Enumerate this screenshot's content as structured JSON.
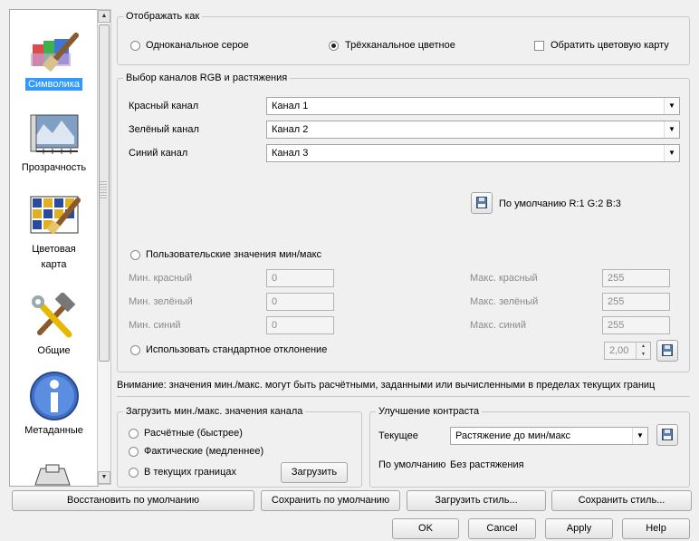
{
  "sidebar": {
    "items": [
      {
        "label": "Символика",
        "icon": "paintbrush-icon",
        "selected": true
      },
      {
        "label": "Прозрачность",
        "icon": "transparency-map-icon",
        "selected": false
      },
      {
        "label": "Цветовая карта",
        "icon": "color-map-icon",
        "selected": false
      },
      {
        "label": "Общие",
        "icon": "tools-icon",
        "selected": false
      },
      {
        "label": "Метаданные",
        "icon": "info-icon",
        "selected": false
      }
    ]
  },
  "display_as": {
    "title": "Отображать как",
    "single_gray": "Одноканальное серое",
    "three_color": "Трёхканальное цветное",
    "invert_map": "Обратить цветовую карту"
  },
  "rgb": {
    "title": "Выбор каналов RGB и растяжения",
    "red_label": "Красный канал",
    "red_value": "Канал 1",
    "green_label": "Зелёный канал",
    "green_value": "Канал 2",
    "blue_label": "Синий канал",
    "blue_value": "Канал 3",
    "default_text": "По умолчанию R:1 G:2 B:3",
    "custom_minmax": "Пользовательские значения мин/макс",
    "min_red_label": "Мин. красный",
    "min_red": "0",
    "min_green_label": "Мин. зелёный",
    "min_green": "0",
    "min_blue_label": "Мин. синий",
    "min_blue": "0",
    "max_red_label": "Макс. красный",
    "max_red": "255",
    "max_green_label": "Макс. зелёный",
    "max_green": "255",
    "max_blue_label": "Макс. синий",
    "max_blue": "255",
    "stddev_label": "Использовать стандартное отклонение",
    "stddev_value": "2,00"
  },
  "warning": "Внимание: значения мин./макс. могут быть расчётными, заданными или вычисленными в пределах текущих границ",
  "load_minmax": {
    "title": "Загрузить мин./макс. значения канала",
    "estimate": "Расчётные (быстрее)",
    "actual": "Фактические (медленнее)",
    "current_extent": "В текущих границах",
    "load_button": "Загрузить"
  },
  "contrast": {
    "title": "Улучшение контраста",
    "current_label": "Текущее",
    "current_value": "Растяжение до мин/макс",
    "default_label": "По умолчанию",
    "default_value": "Без растяжения"
  },
  "bottom": {
    "restore_default": "Восстановить по умолчанию",
    "save_default": "Сохранить по умолчанию",
    "load_style": "Загрузить стиль...",
    "save_style": "Сохранить стиль...",
    "ok": "OK",
    "cancel": "Cancel",
    "apply": "Apply",
    "help": "Help"
  },
  "colors": {
    "selection": "#3399ff",
    "background": "#f0f0f0"
  }
}
